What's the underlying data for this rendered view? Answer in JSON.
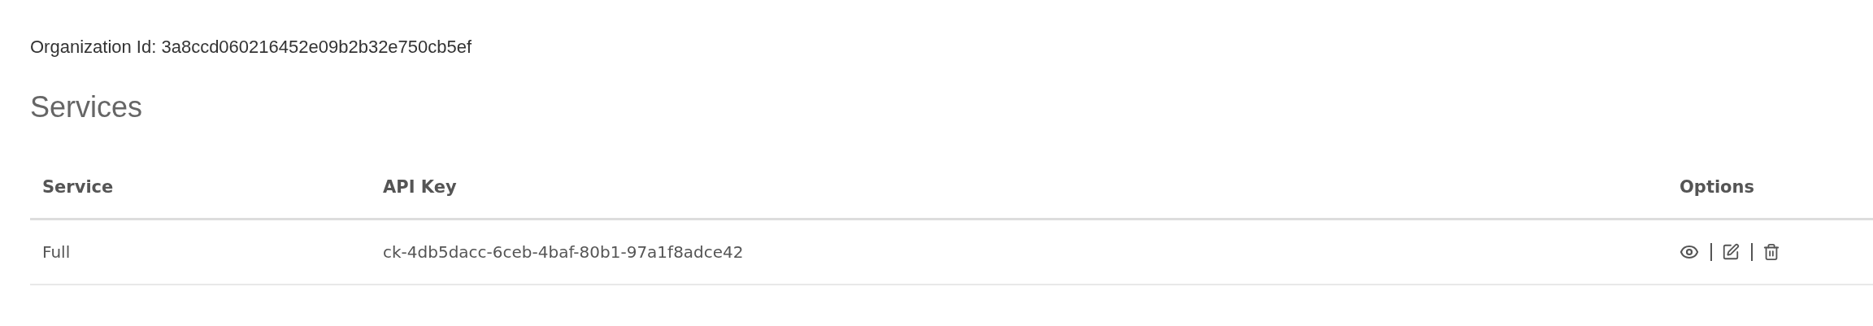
{
  "organization": {
    "label": "Organization Id:",
    "value": "3a8ccd060216452e09b2b32e750cb5ef"
  },
  "section_title": "Services",
  "table": {
    "columns": [
      "Service",
      "API Key",
      "Options"
    ],
    "rows": [
      {
        "service": "Full",
        "api_key": "ck-4db5dacc-6ceb-4baf-80b1-97a1f8adce42"
      }
    ]
  }
}
